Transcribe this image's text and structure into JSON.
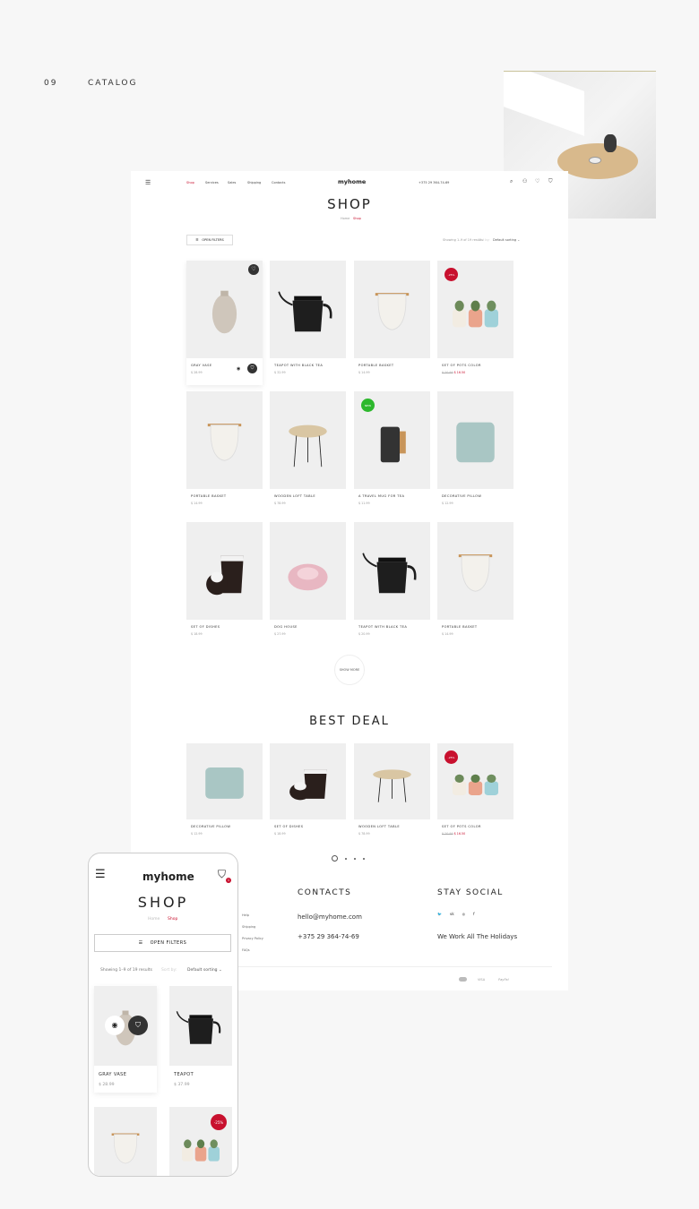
{
  "presentation": {
    "number": "09",
    "section": "CATALOG"
  },
  "colors": {
    "accent": "#c8102e",
    "new_badge": "#2db82d",
    "background": "#f7f7f7"
  },
  "header": {
    "logo": "myhome",
    "nav": [
      "Shop",
      "Services",
      "Sales",
      "Shipping",
      "Contacts"
    ],
    "phone": "+375 29 364-74-69",
    "icons": [
      "menu-icon",
      "search-icon",
      "user-icon",
      "heart-icon",
      "bag-icon"
    ]
  },
  "page": {
    "title": "SHOP",
    "breadcrumb": [
      "Home",
      "Shop"
    ],
    "filters_label": "OPEN FILTERS",
    "results": "Showing 1–9 of 19 results",
    "sort_label": "Sort by:",
    "sort_value": "Default sorting",
    "show_more": "SHOW MORE"
  },
  "products": [
    {
      "name": "GRAY VASE",
      "price": "$ 28.99",
      "img": "vase",
      "fav": true,
      "hover": true
    },
    {
      "name": "TEAPOT WITH BLACK TEA",
      "price": "$ 32.99",
      "img": "teapot"
    },
    {
      "name": "PORTABLE BASKET",
      "price": "$ 14.99",
      "img": "basket"
    },
    {
      "name": "SET OF POTS COLOR",
      "old_price": "$ 20.99",
      "price": "$ 16.50",
      "img": "pots",
      "badge": "-25%"
    },
    {
      "name": "PORTABLE BASKET",
      "price": "$ 14.99",
      "img": "basket"
    },
    {
      "name": "WOODEN LOFT TABLE",
      "price": "$ 78.99",
      "img": "table"
    },
    {
      "name": "A TRAVEL MUG FOR TEA",
      "price": "$ 11.99",
      "img": "mug",
      "badge": "NEW"
    },
    {
      "name": "DECORATIVE PILLOW",
      "price": "$ 12.99",
      "img": "pillow"
    },
    {
      "name": "SET OF DISHES",
      "price": "$ 18.99",
      "img": "dishes"
    },
    {
      "name": "DOG HOUSE",
      "price": "$ 27.99",
      "img": "dog"
    },
    {
      "name": "TEAPOT WITH BLACK TEA",
      "price": "$ 20.99",
      "img": "teapot"
    },
    {
      "name": "PORTABLE BASKET",
      "price": "$ 14.99",
      "img": "basket"
    }
  ],
  "best_deal": {
    "title": "BEST DEAL",
    "items": [
      {
        "name": "DECORATIVE PILLOW",
        "price": "$ 12.99",
        "img": "pillow"
      },
      {
        "name": "SET OF DISHES",
        "price": "$ 18.99",
        "img": "dishes"
      },
      {
        "name": "WOODEN LOFT TABLE",
        "price": "$ 78.99",
        "img": "table"
      },
      {
        "name": "SET OF POTS COLOR",
        "old_price": "$ 20.99",
        "price": "$ 16.50",
        "img": "pots",
        "badge": "-25%"
      }
    ],
    "pages": 4,
    "active_page": 1
  },
  "footer": {
    "links": [
      "Help",
      "Shipping",
      "Privacy Policy",
      "FAQs"
    ],
    "contacts_title": "CONTACTS",
    "email": "hello@myhome.com",
    "phone": "+375 29 364-74-69",
    "social_title": "STAY SOCIAL",
    "social": [
      "twitter-icon",
      "vk-icon",
      "instagram-icon",
      "facebook-icon"
    ],
    "social_glyphs": [
      "🐦",
      "vk",
      "◎",
      "f"
    ],
    "note": "We Work All The Holidays",
    "payments": [
      "VISA",
      "PayPal"
    ]
  },
  "mobile": {
    "logo": "myhome",
    "cart_count": "1",
    "title": "SHOP",
    "breadcrumb": [
      "Home",
      "Shop"
    ],
    "filters_label": "OPEN FILTERS",
    "results": "Showing 1–9 of 19 results",
    "sort_label": "Sort by:",
    "sort_value": "Default sorting",
    "products": [
      {
        "name": "GRAY VASE",
        "price": "$ 28.99",
        "img": "vase",
        "hover": true
      },
      {
        "name": "TEAPOT",
        "price": "$ 37.99",
        "img": "teapot"
      },
      {
        "name": "",
        "price": "",
        "img": "basket"
      },
      {
        "name": "",
        "price": "",
        "img": "pots",
        "badge": "-25%"
      }
    ]
  }
}
